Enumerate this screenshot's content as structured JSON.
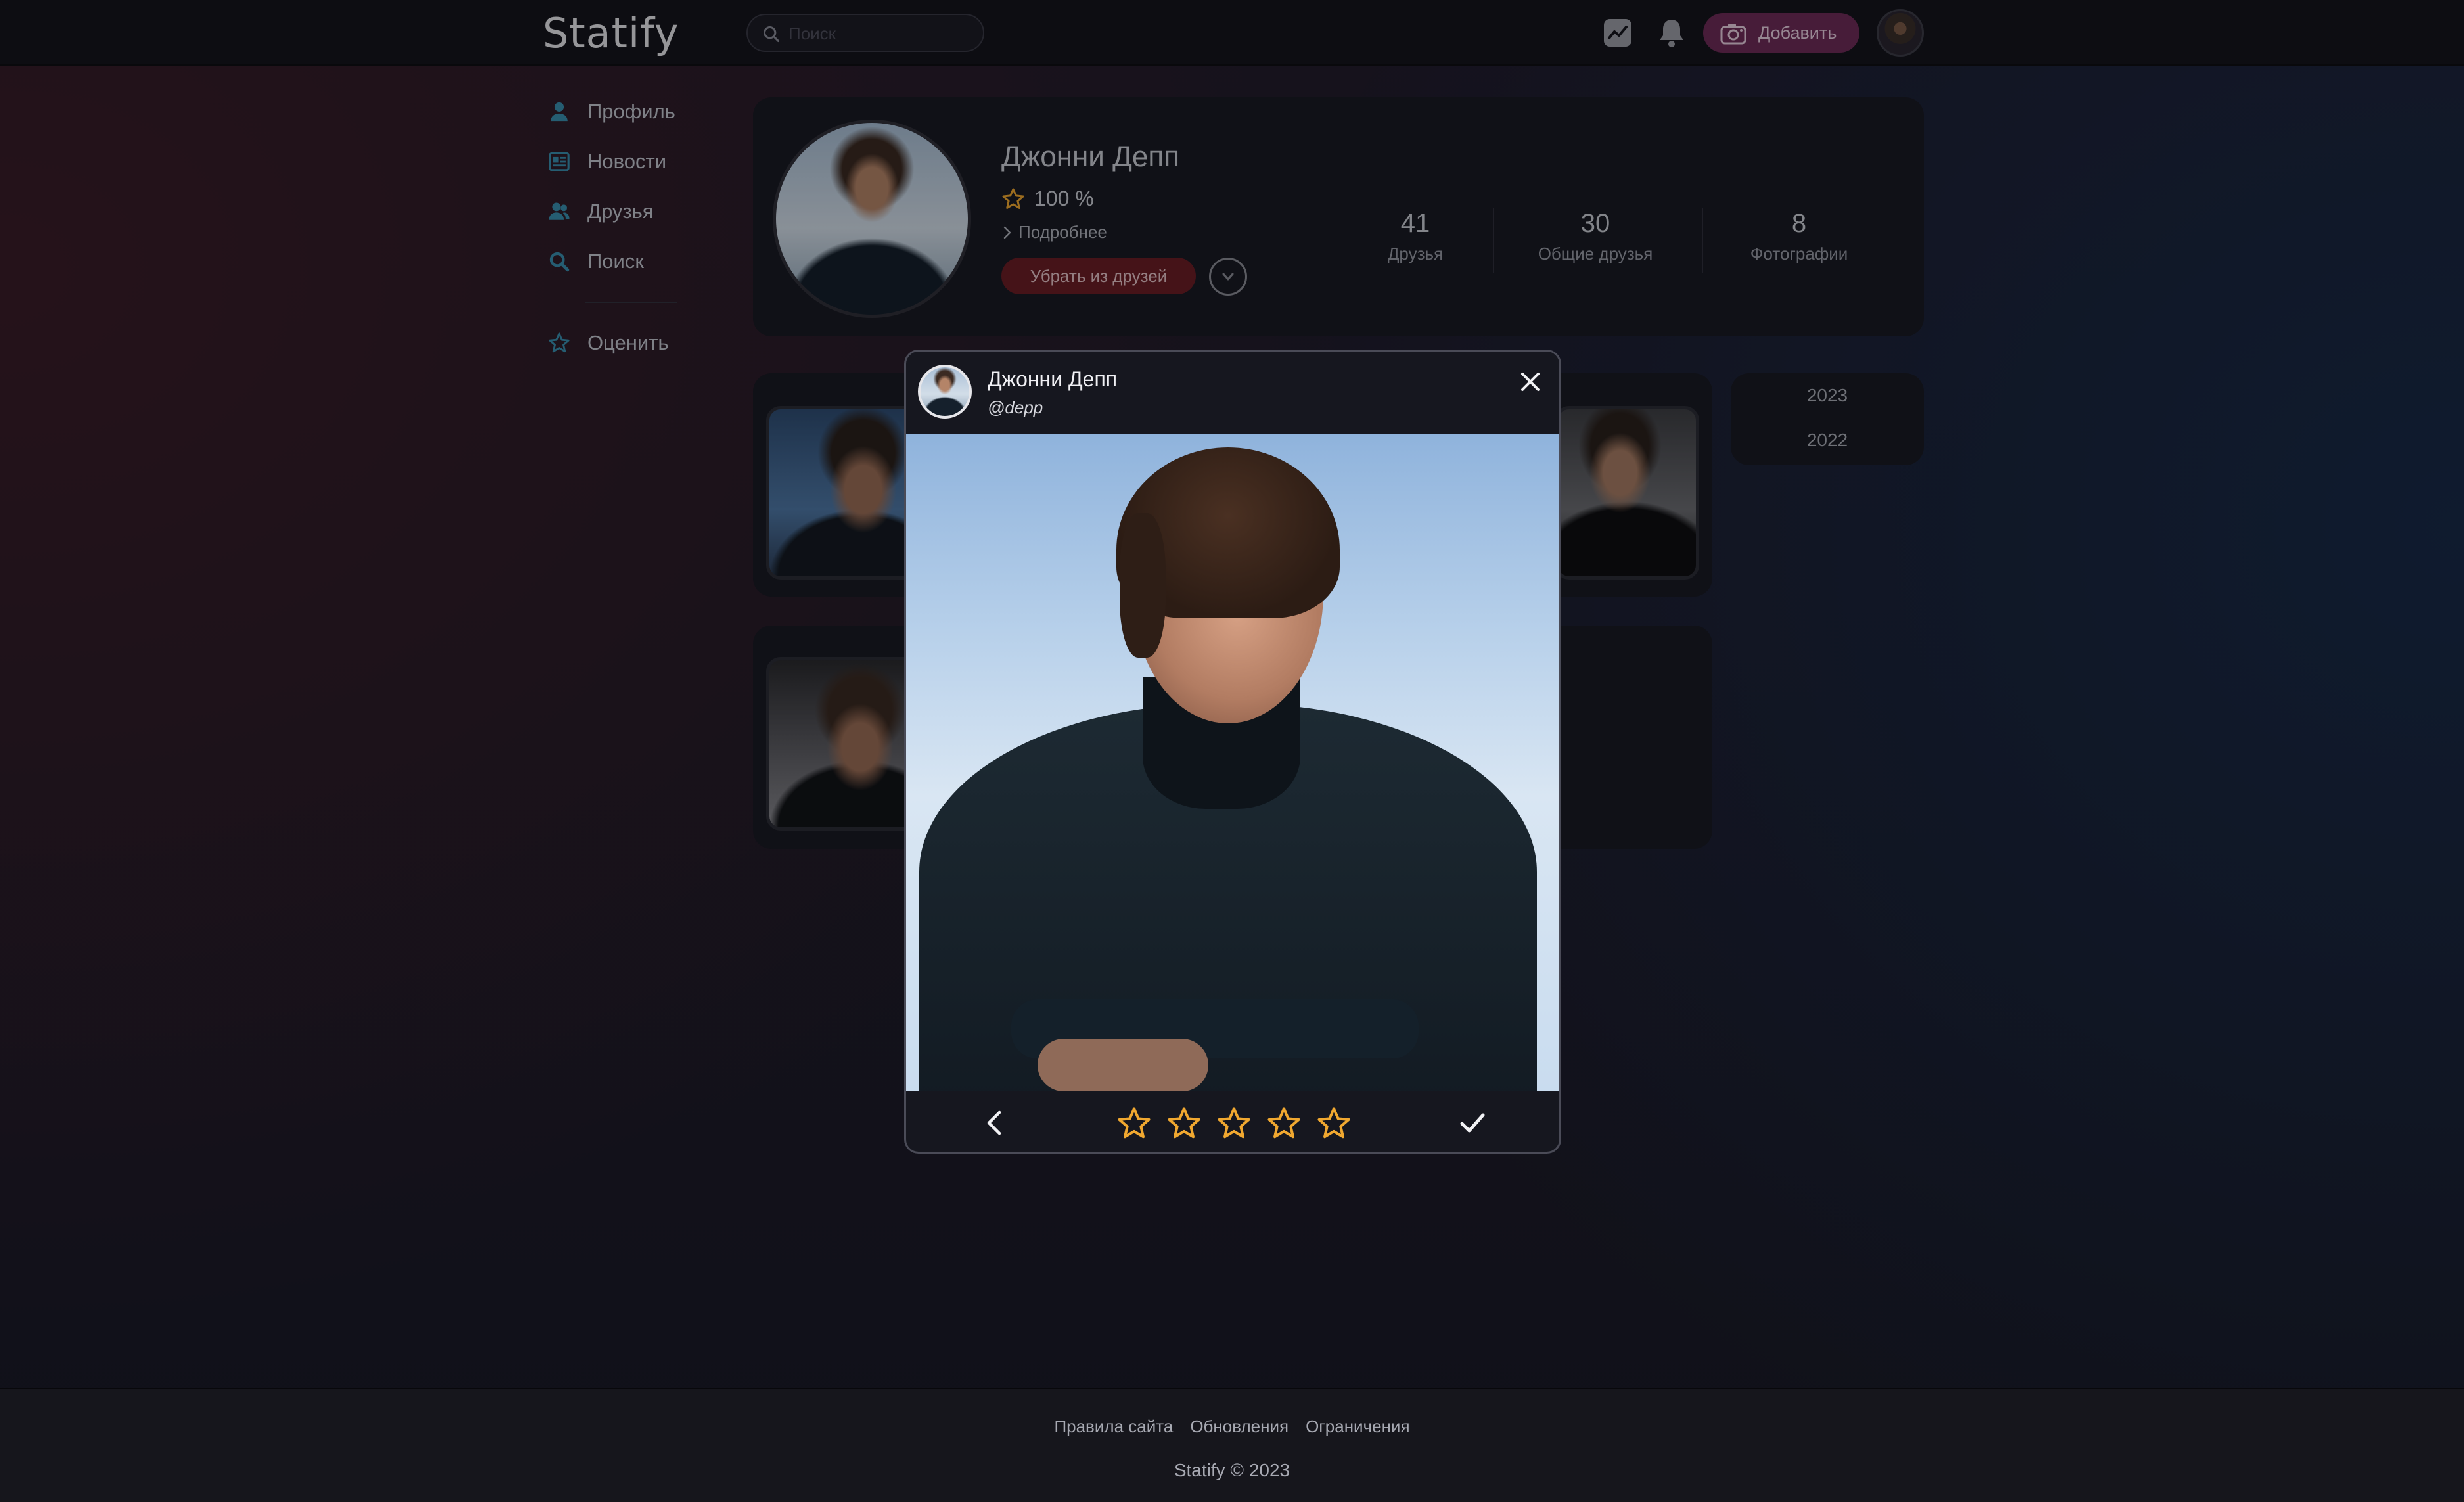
{
  "app": {
    "logo": "Statify"
  },
  "header": {
    "search_placeholder": "Поиск",
    "add_label": "Добавить",
    "accent_color": "#6e2c58"
  },
  "sidebar": {
    "items": [
      {
        "label": "Профиль",
        "icon": "user-icon"
      },
      {
        "label": "Новости",
        "icon": "news-icon"
      },
      {
        "label": "Друзья",
        "icon": "friends-icon"
      },
      {
        "label": "Поиск",
        "icon": "search-icon"
      }
    ],
    "rate": {
      "label": "Оценить",
      "icon": "star-icon"
    }
  },
  "profile": {
    "name": "Джонни Депп",
    "rating": "100 %",
    "more": "Подробнее",
    "unfriend": "Убрать из друзей",
    "stats": [
      {
        "value": "41",
        "label": "Друзья"
      },
      {
        "value": "30",
        "label": "Общие друзья"
      },
      {
        "value": "8",
        "label": "Фотографии"
      }
    ]
  },
  "years": [
    "2023",
    "2022"
  ],
  "modal": {
    "name": "Джонни Депп",
    "handle": "@depp",
    "stars_total": 5,
    "stars_selected": 0,
    "star_color": "#f0a830"
  },
  "footer": {
    "links": [
      "Правила сайта",
      "Обновления",
      "Ограничения"
    ],
    "copyright": "Statify © 2023"
  }
}
